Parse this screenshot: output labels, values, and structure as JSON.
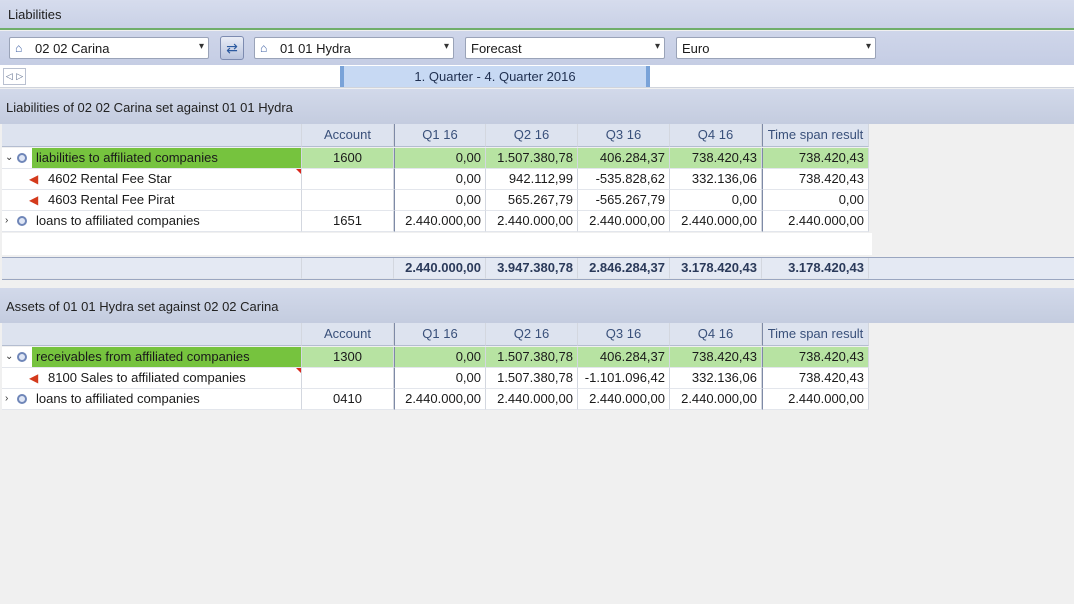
{
  "window": {
    "title": "Liabilities"
  },
  "toolbar": {
    "company_from": "02 02 Carina",
    "company_to": "01 01 Hydra",
    "scenario": "Forecast",
    "currency": "Euro"
  },
  "period": {
    "label": "1. Quarter - 4. Quarter 2016"
  },
  "columns": [
    "Account",
    "Q1 16",
    "Q2 16",
    "Q3 16",
    "Q4 16",
    "Time span result"
  ],
  "liabilities": {
    "title": "Liabilities of 02 02 Carina set against 01 01 Hydra",
    "rows": [
      {
        "name": "liabilities to affiliated companies",
        "account": "1600",
        "q1": "0,00",
        "q2": "1.507.380,78",
        "q3": "406.284,37",
        "q4": "738.420,43",
        "ts": "738.420,43"
      },
      {
        "name": "4602 Rental Fee Star",
        "account": "",
        "q1": "0,00",
        "q2": "942.112,99",
        "q3": "-535.828,62",
        "q4": "332.136,06",
        "ts": "738.420,43"
      },
      {
        "name": "4603 Rental Fee Pirat",
        "account": "",
        "q1": "0,00",
        "q2": "565.267,79",
        "q3": "-565.267,79",
        "q4": "0,00",
        "ts": "0,00"
      },
      {
        "name": "loans to affiliated companies",
        "account": "1651",
        "q1": "2.440.000,00",
        "q2": "2.440.000,00",
        "q3": "2.440.000,00",
        "q4": "2.440.000,00",
        "ts": "2.440.000,00"
      }
    ],
    "totals": {
      "q1": "2.440.000,00",
      "q2": "3.947.380,78",
      "q3": "2.846.284,37",
      "q4": "3.178.420,43",
      "ts": "3.178.420,43"
    }
  },
  "assets": {
    "title": "Assets of 01 01 Hydra set against 02 02 Carina",
    "rows": [
      {
        "name": "receivables from affiliated companies",
        "account": "1300",
        "q1": "0,00",
        "q2": "1.507.380,78",
        "q3": "406.284,37",
        "q4": "738.420,43",
        "ts": "738.420,43"
      },
      {
        "name": "8100 Sales to affiliated companies",
        "account": "",
        "q1": "0,00",
        "q2": "1.507.380,78",
        "q3": "-1.101.096,42",
        "q4": "332.136,06",
        "ts": "738.420,43"
      },
      {
        "name": "loans to affiliated companies",
        "account": "0410",
        "q1": "2.440.000,00",
        "q2": "2.440.000,00",
        "q3": "2.440.000,00",
        "q4": "2.440.000,00",
        "ts": "2.440.000,00"
      }
    ]
  }
}
